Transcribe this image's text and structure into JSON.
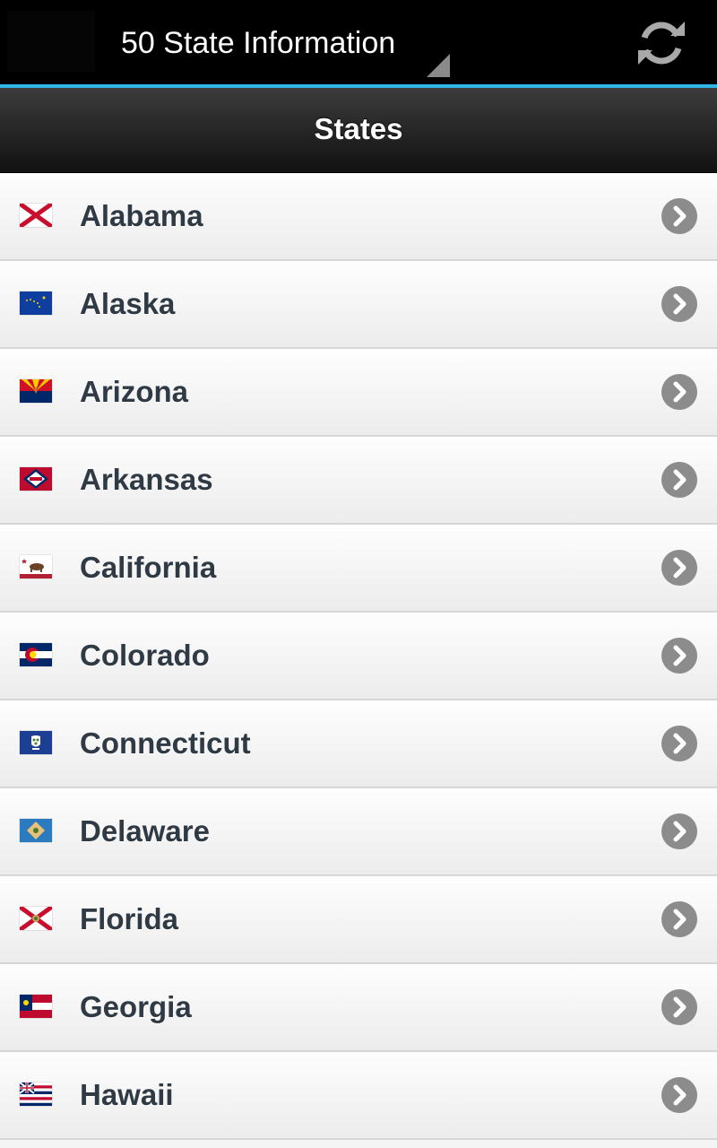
{
  "action_bar": {
    "app_title": "50 State Information",
    "refresh_icon": "refresh-icon",
    "app_icon": "app-icon"
  },
  "header": {
    "title": "States"
  },
  "colors": {
    "accent_line": "#33b5e5",
    "row_text": "#2f3a44",
    "chevron_bg": "#8c8c8c"
  },
  "states": [
    {
      "label": "Alabama",
      "flag_icon": "alabama-flag-icon"
    },
    {
      "label": "Alaska",
      "flag_icon": "alaska-flag-icon"
    },
    {
      "label": "Arizona",
      "flag_icon": "arizona-flag-icon"
    },
    {
      "label": "Arkansas",
      "flag_icon": "arkansas-flag-icon"
    },
    {
      "label": "California",
      "flag_icon": "california-flag-icon"
    },
    {
      "label": "Colorado",
      "flag_icon": "colorado-flag-icon"
    },
    {
      "label": "Connecticut",
      "flag_icon": "connecticut-flag-icon"
    },
    {
      "label": "Delaware",
      "flag_icon": "delaware-flag-icon"
    },
    {
      "label": "Florida",
      "flag_icon": "florida-flag-icon"
    },
    {
      "label": "Georgia",
      "flag_icon": "georgia-flag-icon"
    },
    {
      "label": "Hawaii",
      "flag_icon": "hawaii-flag-icon"
    }
  ]
}
